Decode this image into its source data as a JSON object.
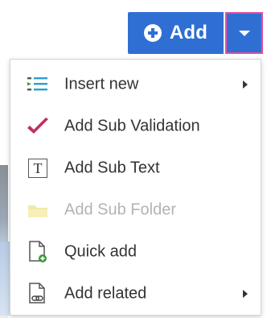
{
  "toolbar": {
    "add_label": "Add"
  },
  "menu": {
    "items": [
      {
        "label": "Insert new",
        "icon": "insert-list-icon",
        "has_submenu": true,
        "disabled": false
      },
      {
        "label": "Add Sub Validation",
        "icon": "checkmark-icon",
        "has_submenu": false,
        "disabled": false
      },
      {
        "label": "Add Sub Text",
        "icon": "text-t-icon",
        "has_submenu": false,
        "disabled": false
      },
      {
        "label": "Add Sub Folder",
        "icon": "folder-icon",
        "has_submenu": false,
        "disabled": true
      },
      {
        "label": "Quick add",
        "icon": "document-add-icon",
        "has_submenu": false,
        "disabled": false
      },
      {
        "label": "Add related",
        "icon": "document-link-icon",
        "has_submenu": true,
        "disabled": false
      }
    ]
  },
  "colors": {
    "primary": "#2f6fd3",
    "focus_border": "#e24fa0",
    "disabled_text": "#b3b3b3",
    "text": "#333333",
    "checkmark": "#c0305b"
  }
}
